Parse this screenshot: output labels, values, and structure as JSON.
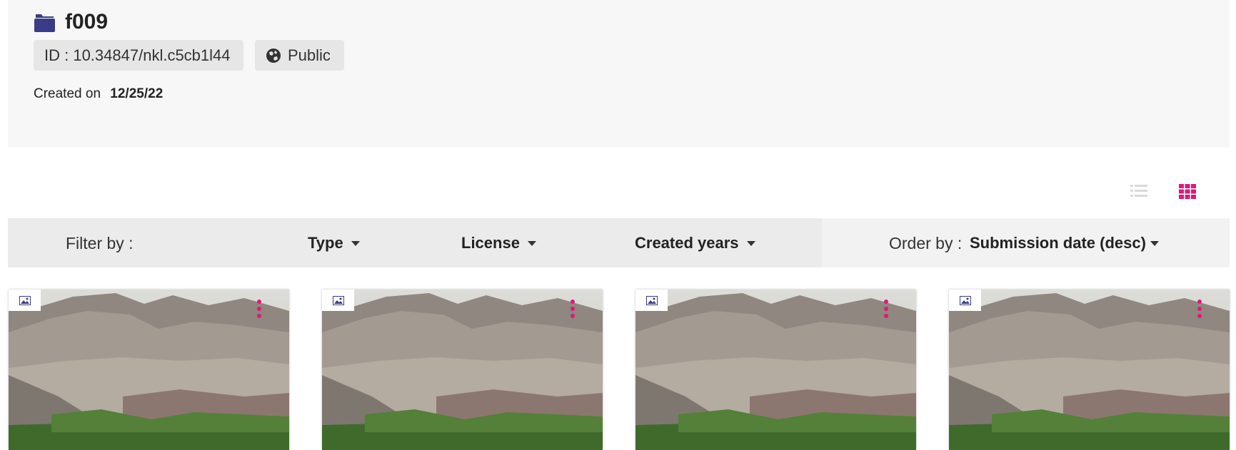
{
  "dataset": {
    "title": "f009",
    "icon": "folder-icon",
    "id_label": "ID : 10.34847/nkl.c5cb1l44",
    "visibility": "Public",
    "visibility_icon": "globe-icon",
    "created_label": "Created on",
    "created_date": "12/25/22"
  },
  "view": {
    "list_icon": "list-view-icon",
    "grid_icon": "grid-view-icon",
    "active": "grid",
    "accent_color": "#e0187a"
  },
  "filters": {
    "label": "Filter by :",
    "type": "Type",
    "license": "License",
    "created_years": "Created years"
  },
  "order": {
    "label": "Order by :",
    "value": "Submission date (desc)"
  },
  "cards": [
    {
      "type_icon": "image-icon",
      "menu_icon": "more-vertical-icon"
    },
    {
      "type_icon": "image-icon",
      "menu_icon": "more-vertical-icon"
    },
    {
      "type_icon": "image-icon",
      "menu_icon": "more-vertical-icon"
    },
    {
      "type_icon": "image-icon",
      "menu_icon": "more-vertical-icon"
    }
  ]
}
